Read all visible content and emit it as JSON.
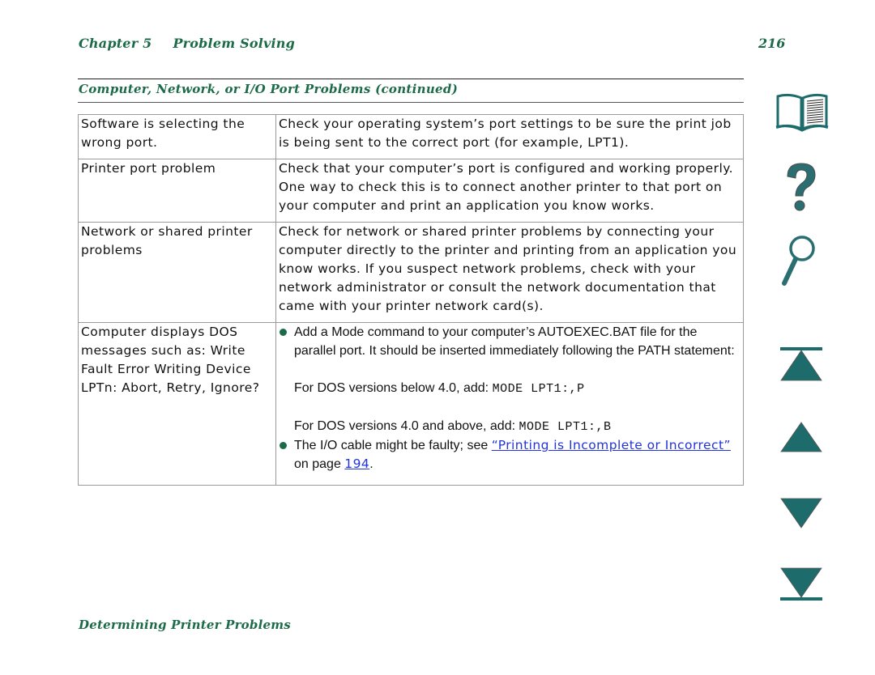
{
  "header": {
    "chapter_label": "Chapter 5",
    "chapter_title": "Problem Solving",
    "page_number": "216"
  },
  "section": {
    "title": "Computer, Network, or I/O Port Problems (continued)"
  },
  "table": {
    "rows": [
      {
        "problem": "Software is selecting the wrong port.",
        "solution": "Check your operating system’s port settings to be sure the print job is being sent to the correct port (for example, LPT1)."
      },
      {
        "problem": "Printer port problem",
        "solution": "Check that your computer’s port is configured and working properly. One way to check this is to connect another printer to that port on your computer and print an application you know works."
      },
      {
        "problem": "Network or shared printer problems",
        "solution": "Check for network or shared printer problems by connecting your computer directly to the printer and printing from an application you know works. If you suspect network problems, check with your network administrator or consult the network documentation that came with your printer network card(s)."
      },
      {
        "problem": "Computer displays DOS messages such as: Write Fault Error Writing Device LPTn: Abort, Retry, Ignore?",
        "bullets": [
          {
            "text": "Add a Mode command to your computer’s AUTOEXEC.BAT file for the parallel port. It should be inserted immediately following the PATH statement:",
            "commands": [
              {
                "prefix": "For DOS versions below 4.0, add: ",
                "code": "MODE LPT1:,P"
              },
              {
                "prefix": "For DOS versions 4.0 and above, add: ",
                "code": "MODE LPT1:,B"
              }
            ]
          },
          {
            "text_before": "The I/O cable might be faulty; see ",
            "link_text": "“Printing is Incomplete or Incorrect”",
            "text_middle": " on page ",
            "page_link": "194",
            "text_after": "."
          }
        ]
      }
    ]
  },
  "nav": {
    "icons": [
      {
        "name": "contents-book-icon",
        "label": "Contents"
      },
      {
        "name": "help-question-icon",
        "label": "Help"
      },
      {
        "name": "search-magnifier-icon",
        "label": "Index / Search"
      },
      {
        "name": "first-page-icon",
        "label": "First page"
      },
      {
        "name": "previous-page-icon",
        "label": "Previous page"
      },
      {
        "name": "next-page-icon",
        "label": "Next page"
      },
      {
        "name": "last-page-icon",
        "label": "Last page"
      }
    ],
    "accent_color": "#1e6b6b"
  },
  "footer": {
    "title": "Determining Printer Problems"
  },
  "colors": {
    "heading_green": "#1c6b48",
    "link_blue": "#2233dd",
    "nav_teal": "#1e6b6b"
  }
}
